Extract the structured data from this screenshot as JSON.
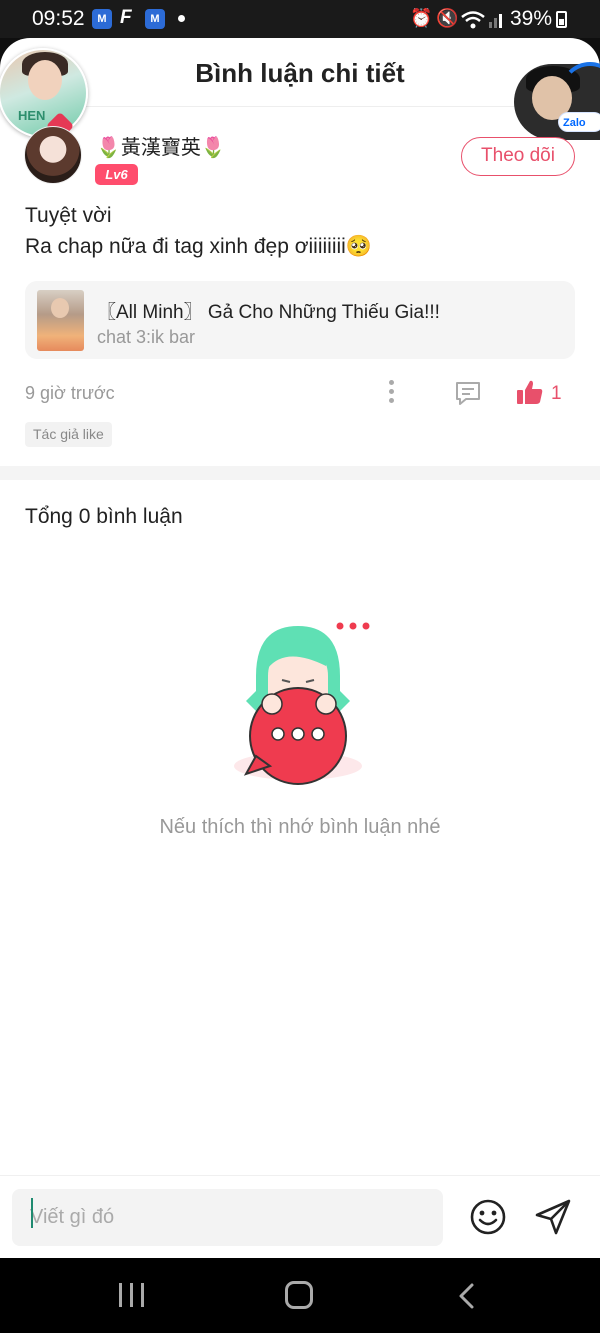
{
  "status_bar": {
    "time": "09:52",
    "app_icon_1": "facebook-messenger-icon",
    "app_icon_2": "F",
    "app_icon_3": "facebook-messenger-icon",
    "battery": "39%"
  },
  "header": {
    "title": "Bình luận chi tiết"
  },
  "floating": {
    "zalo_label": "Zalo"
  },
  "comment": {
    "username": "🌷黃漢寶英🌷",
    "level": "Lv6",
    "follow_label": "Theo dõi",
    "lines": [
      "Tuyệt vời",
      "Ra chap nữa đi tag xinh đẹp ơiiiiiiii🥺"
    ],
    "story": {
      "title": "〖All Minh〗 Gả Cho Những Thiếu Gia!!!",
      "chapter": "chat 3:ik bar"
    },
    "time_ago": "9 giờ trước",
    "like_count": "1",
    "author_like_label": "Tác giả like"
  },
  "replies": {
    "total_label": "Tổng 0 bình luận",
    "empty_message": "Nếu thích thì nhớ bình luận nhé"
  },
  "input": {
    "placeholder": "Viết gì đó"
  },
  "colors": {
    "accent": "#e8506b",
    "level_badge": "#ff4d6d",
    "mascot_hair": "#5fe0b4",
    "mascot_bubble": "#ef3b4f"
  }
}
